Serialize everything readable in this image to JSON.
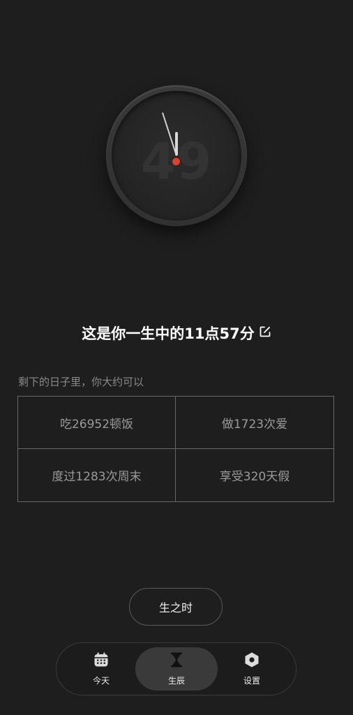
{
  "clock": {
    "age_display": "49"
  },
  "headline": {
    "text": "这是你一生中的11点57分"
  },
  "stats": {
    "intro": "剩下的日子里，你大约可以",
    "items": [
      {
        "label": "吃26952顿饭"
      },
      {
        "label": "做1723次爱"
      },
      {
        "label": "度过1283次周末"
      },
      {
        "label": "享受320天假"
      }
    ]
  },
  "action": {
    "label": "生之时"
  },
  "tabbar": {
    "tabs": [
      {
        "label": "今天",
        "icon": "calendar-icon"
      },
      {
        "label": "生辰",
        "icon": "hourglass-icon"
      },
      {
        "label": "设置",
        "icon": "settings-hex-icon"
      }
    ],
    "active_index": 1
  },
  "colors": {
    "background": "#1e1e1e",
    "accent_dot": "#d9422e",
    "grid_border": "#666666",
    "muted_text": "#8a8a8a"
  }
}
